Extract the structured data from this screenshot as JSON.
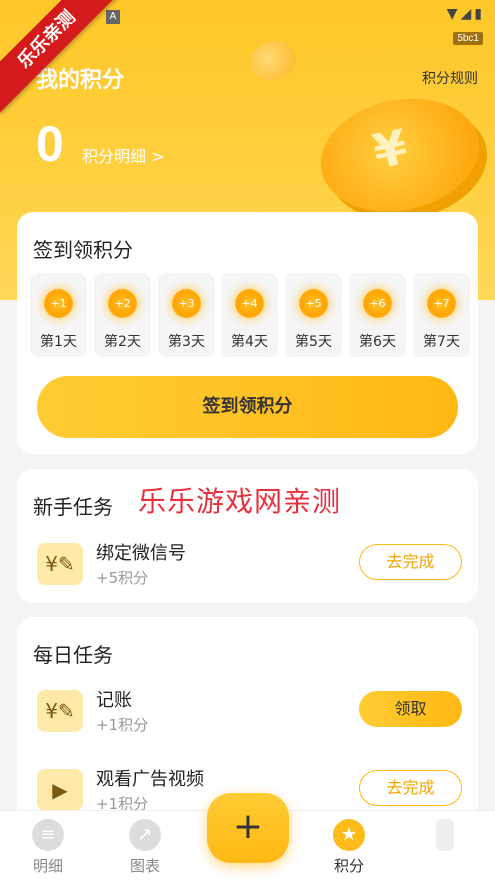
{
  "status_bar": {
    "a_icon": "A",
    "icons": "▼◢▮",
    "badge": "5bc1"
  },
  "ribbon": "乐乐亲测",
  "header": {
    "title": "我的积分",
    "rules": "积分规则",
    "points": "0",
    "detail_link": "积分明细 >"
  },
  "signin": {
    "title": "签到领积分",
    "days": [
      {
        "reward": "+1",
        "label": "第1天"
      },
      {
        "reward": "+2",
        "label": "第2天"
      },
      {
        "reward": "+3",
        "label": "第3天"
      },
      {
        "reward": "+4",
        "label": "第4天"
      },
      {
        "reward": "+5",
        "label": "第5天"
      },
      {
        "reward": "+6",
        "label": "第6天"
      },
      {
        "reward": "+7",
        "label": "第7天"
      }
    ],
    "button": "签到领积分"
  },
  "watermark": "乐乐游戏网亲测",
  "newbie": {
    "title": "新手任务",
    "tasks": [
      {
        "name": "绑定微信号",
        "reward": "+5积分",
        "action": "去完成",
        "icon": "receipt-pen-icon"
      }
    ]
  },
  "daily": {
    "title": "每日任务",
    "tasks": [
      {
        "name": "记账",
        "reward": "+1积分",
        "action": "领取",
        "icon": "receipt-pen-icon"
      },
      {
        "name": "观看广告视频",
        "reward": "+1积分",
        "action": "去完成",
        "icon": "video-play-icon"
      }
    ]
  },
  "tabbar": {
    "tabs": [
      {
        "label": "明细",
        "icon": "ledger-icon"
      },
      {
        "label": "图表",
        "icon": "chart-icon"
      },
      {
        "label": "积分",
        "icon": "star-icon"
      }
    ],
    "fab": "+"
  },
  "colors": {
    "accent": "#ffbb1a",
    "hero_bg": "#ffc728",
    "watermark": "#e8303d"
  }
}
